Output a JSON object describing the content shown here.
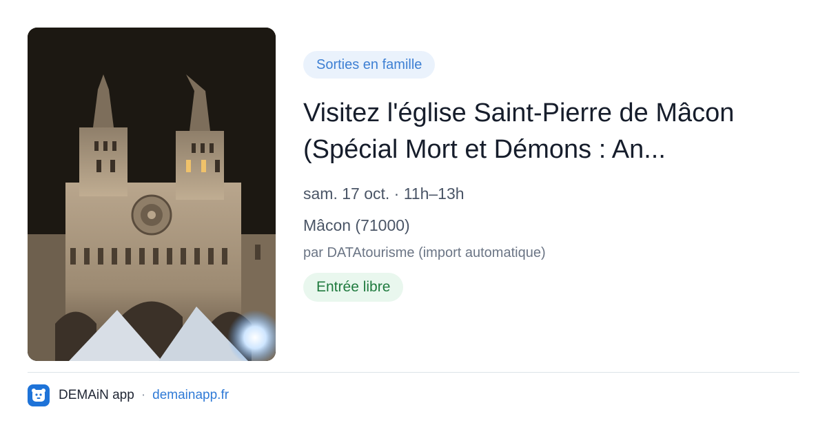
{
  "event": {
    "category": "Sorties en famille",
    "title": "Visitez l'église Saint-Pierre de Mâcon (Spécial Mort et Démons : An...",
    "datetime": "sam. 17 oct. · 11h–13h",
    "location": "Mâcon (71000)",
    "source": "par DATAtourisme (import automatique)",
    "price": "Entrée libre",
    "image": "church-facade-night-photo"
  },
  "footer": {
    "app_name": "DEMAiN app",
    "separator": "·",
    "domain": "demainapp.fr",
    "logo_icon": "demain-bear-logo-icon"
  },
  "colors": {
    "category_pill_bg": "#eaf2fc",
    "category_pill_text": "#3d7fd3",
    "price_pill_bg": "#e9f7ee",
    "price_pill_text": "#1f7a3e",
    "title_text": "#161d2b",
    "link": "#2f7ad6",
    "logo_bg": "#1e73d8"
  }
}
